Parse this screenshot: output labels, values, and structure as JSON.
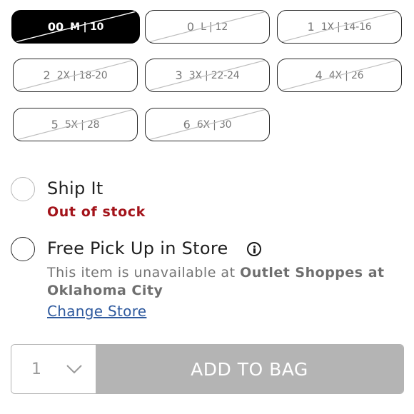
{
  "sizes": [
    {
      "main": "00",
      "sub": "M | 10",
      "selected": true
    },
    {
      "main": "0",
      "sub": "L | 12",
      "selected": false
    },
    {
      "main": "1",
      "sub": "1X | 14-16",
      "selected": false
    },
    {
      "main": "2",
      "sub": "2X | 18-20",
      "selected": false
    },
    {
      "main": "3",
      "sub": "3X | 22-24",
      "selected": false
    },
    {
      "main": "4",
      "sub": "4X | 26",
      "selected": false
    },
    {
      "main": "5",
      "sub": "5X | 28",
      "selected": false
    },
    {
      "main": "6",
      "sub": "6X | 30",
      "selected": false
    }
  ],
  "shipping": {
    "ship_label": "Ship It",
    "ship_status": "Out of stock",
    "pickup_label": "Free Pick Up in Store",
    "info_icon": "info-icon",
    "unavailable_prefix": "This item is unavailable at",
    "store_name": "Outlet Shoppes at Oklahoma City",
    "change_store": "Change Store"
  },
  "purchase": {
    "quantity": "1",
    "add_to_bag": "ADD TO BAG"
  },
  "colors": {
    "selected_bg": "#000000",
    "out_of_stock": "#a3131a",
    "link": "#2f5a9e",
    "disabled_button": "#b4b4b4"
  }
}
